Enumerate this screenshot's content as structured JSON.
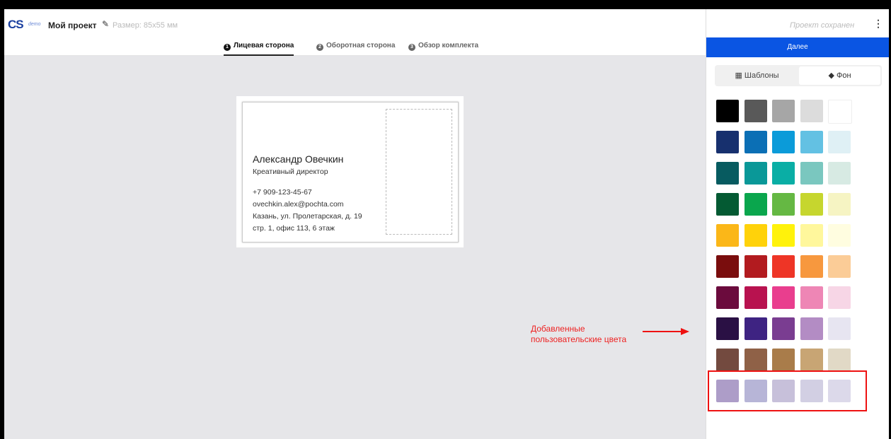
{
  "header": {
    "logo": "CS",
    "logo_badge": "demo",
    "project_name": "Мой проект",
    "size_label": "Размер: 85x55 мм",
    "save_status": "Проект сохранен"
  },
  "tabs": [
    {
      "num": "1",
      "label": "Лицевая сторона"
    },
    {
      "num": "2",
      "label": "Оборотная сторона"
    },
    {
      "num": "3",
      "label": "Обзор комплекта"
    }
  ],
  "card": {
    "name": "Александр Овечкин",
    "role": "Креативный директор",
    "phone": "+7 909-123-45-67",
    "email": "ovechkin.alex@pochta.com",
    "address1": "Казань, ул. Пролетарская, д. 19",
    "address2": "стр. 1, офис 113, 6 этаж"
  },
  "annotation": {
    "line1": "Добавленные",
    "line2": "пользовательские цвета"
  },
  "panel": {
    "next_label": "Далее",
    "seg_templates": "Шаблоны",
    "seg_background": "Фон"
  },
  "palette": [
    [
      "#000000",
      "#595959",
      "#a6a6a6",
      "#dcdcdc",
      "#ffffff"
    ],
    [
      "#17306e",
      "#0b6fb5",
      "#0b9bd9",
      "#63c1e3",
      "#dff0f5"
    ],
    [
      "#075b60",
      "#0a9898",
      "#0aaea5",
      "#7ac7bf",
      "#d7eae3"
    ],
    [
      "#045a33",
      "#0aa64d",
      "#65b843",
      "#c6d62e",
      "#f6f4c3"
    ],
    [
      "#fbb718",
      "#ffd20a",
      "#fff20b",
      "#fff79c",
      "#fffde0"
    ],
    [
      "#7a0d0d",
      "#b21b1f",
      "#ee3526",
      "#f7983e",
      "#fbcc97"
    ],
    [
      "#6b0b3d",
      "#b8124f",
      "#e93e8e",
      "#ee86b5",
      "#f7d6e6"
    ],
    [
      "#2a1044",
      "#3e2382",
      "#7a3d91",
      "#b38cc4",
      "#e7e5f1"
    ],
    [
      "#734a3f",
      "#8f6147",
      "#a97c4a",
      "#c8a574",
      "#e1d9c6"
    ],
    [
      "#ad9dc8",
      "#b7b5d7",
      "#c7c0da",
      "#d2cfe3",
      "#dcd9ea"
    ]
  ]
}
